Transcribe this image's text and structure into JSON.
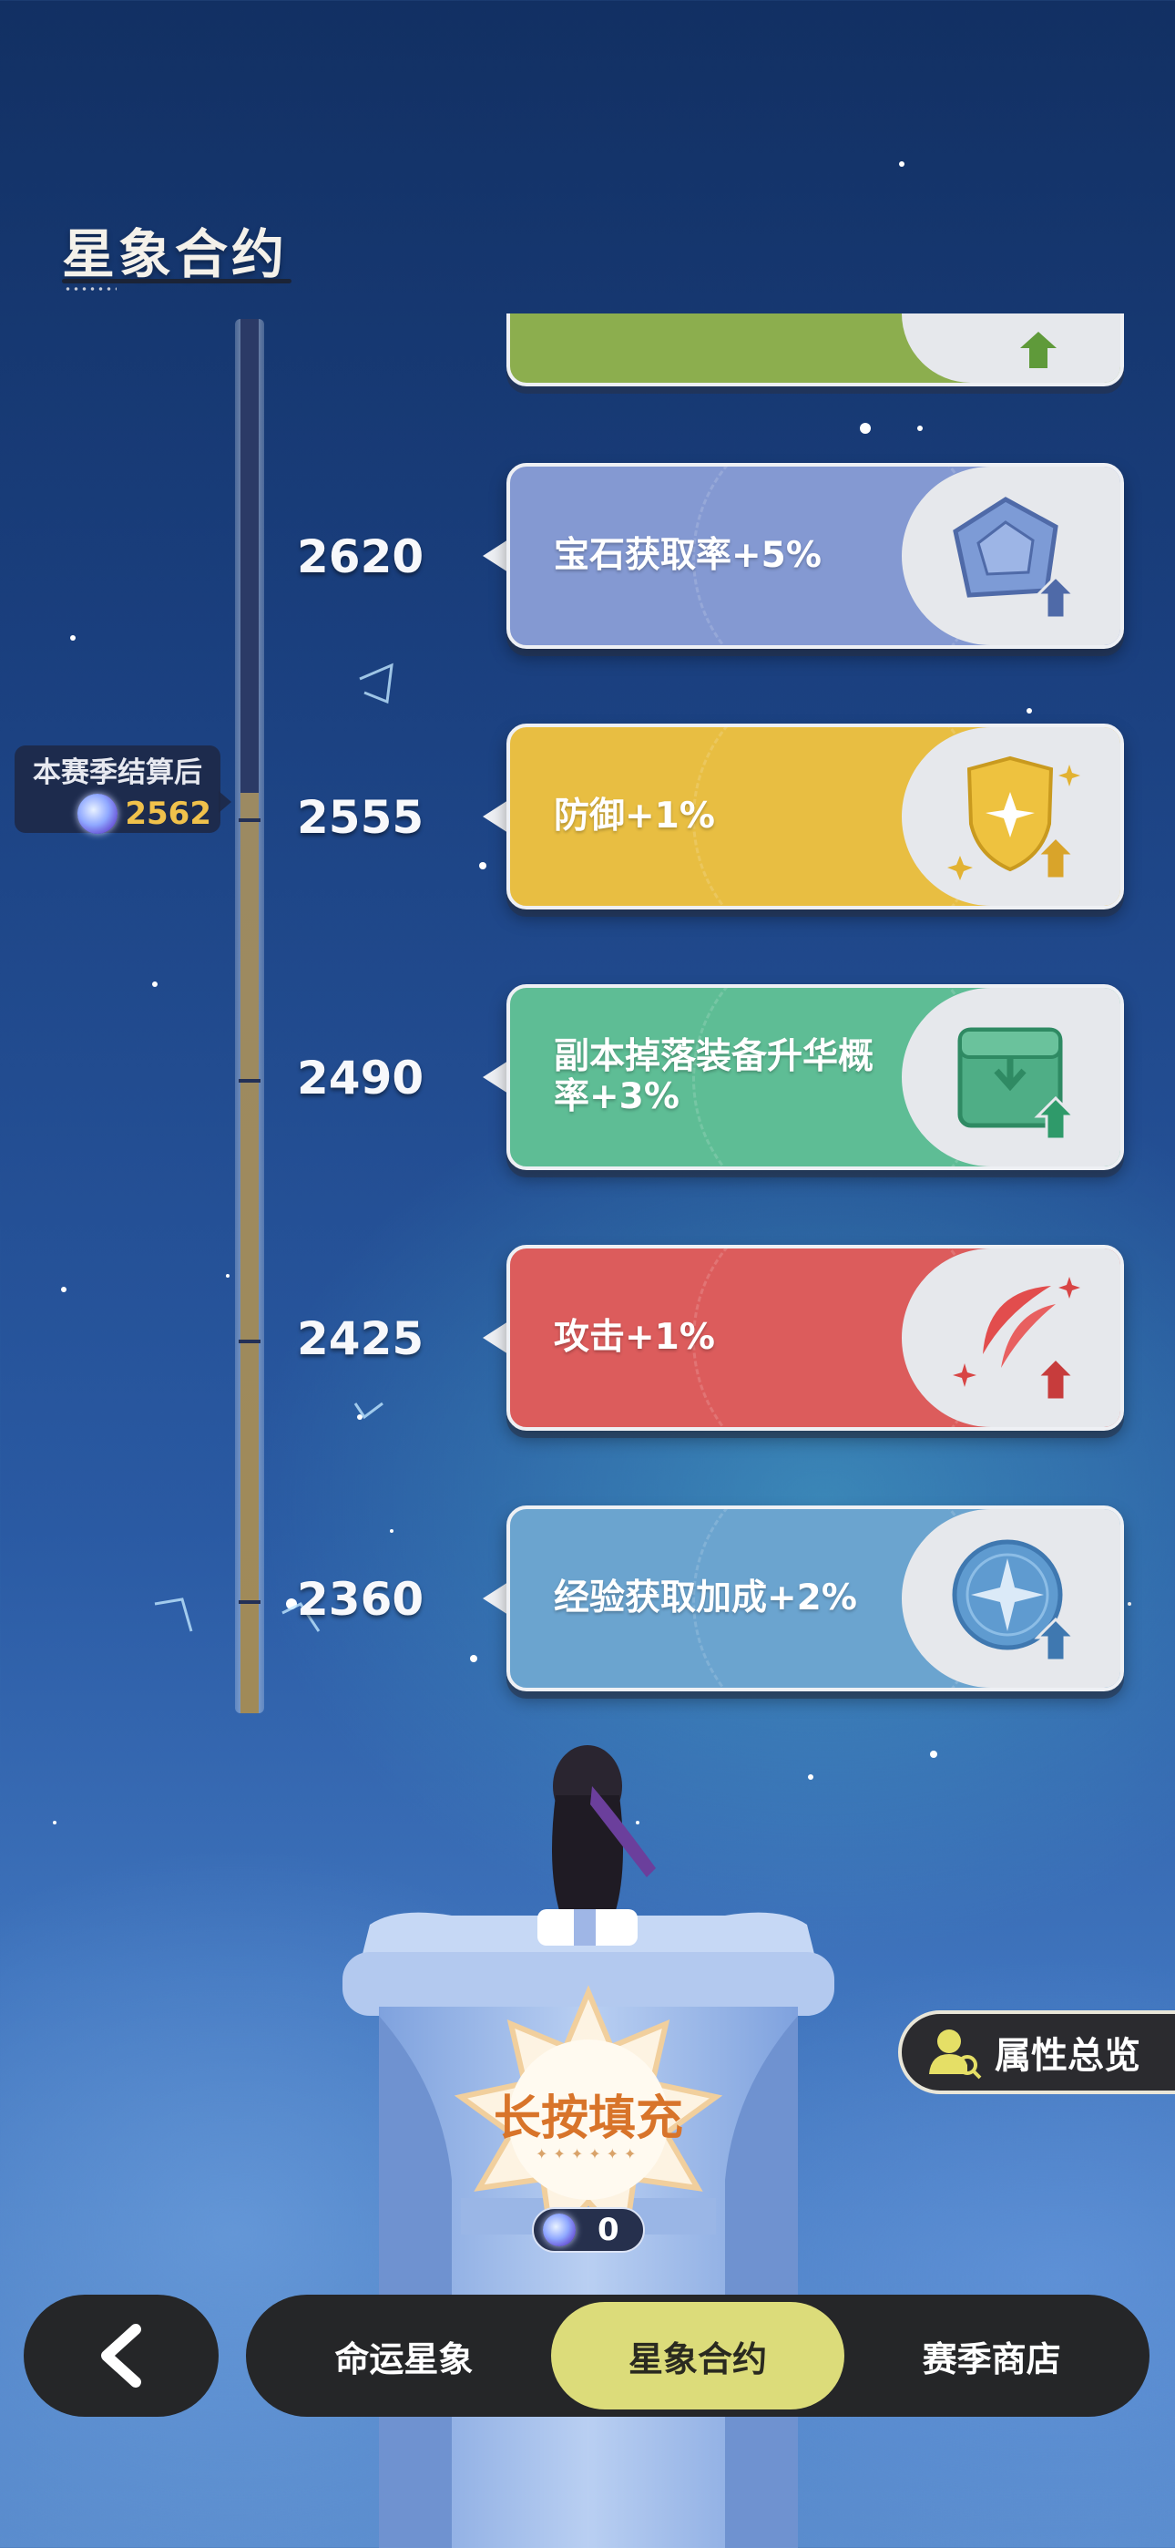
{
  "header": {
    "title": "星象合约"
  },
  "season_marker": {
    "label": "本赛季结算后",
    "value": "2562"
  },
  "milestones": [
    {
      "level": "2620",
      "reward": "宝石获取率+5%",
      "color": "#8499d2",
      "icon": "gem-upgrade-icon"
    },
    {
      "level": "2555",
      "reward": "防御+1%",
      "color": "#e8be42",
      "icon": "shield-upgrade-icon"
    },
    {
      "level": "2490",
      "reward": "副本掉落装备升华概率+3%",
      "color": "#5ebd95",
      "icon": "chest-upgrade-icon"
    },
    {
      "level": "2425",
      "reward": "攻击+1%",
      "color": "#dc5c5c",
      "icon": "slash-upgrade-icon"
    },
    {
      "level": "2360",
      "reward": "经验获取加成+2%",
      "color": "#6ba4cf",
      "icon": "star-orb-upgrade-icon"
    }
  ],
  "fill_button": {
    "label": "长按填充"
  },
  "counter": {
    "value": "0"
  },
  "attribute_overview": {
    "label": "属性总览"
  },
  "nav": {
    "tabs": [
      {
        "label": "命运星象",
        "active": false
      },
      {
        "label": "星象合约",
        "active": true
      },
      {
        "label": "赛季商店",
        "active": false
      }
    ]
  },
  "progress": {
    "season_value": 2562,
    "current_value": 0
  }
}
